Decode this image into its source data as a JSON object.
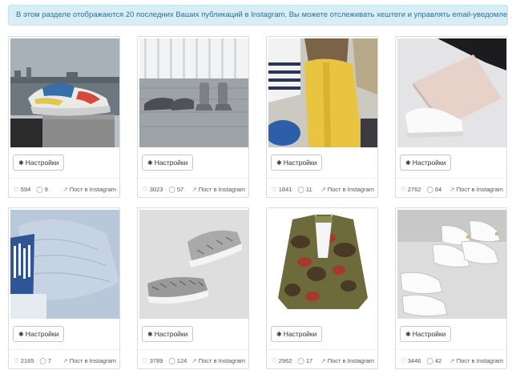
{
  "info_text": "В этом разделе отображаются 20 последних Ваших публикаций в Instagram. Вы можете отслеживать хештеги и управлять email-уведомлениями.",
  "settings_label": "Настройки",
  "post_link_label": "Пост в Instagram",
  "icons": {
    "settings": "gear-icon",
    "likes": "heart-icon",
    "comments": "comment-icon",
    "post": "external-link-icon"
  },
  "colors": {
    "info_bg": "#d9edf7",
    "info_text": "#31708f",
    "card_border": "#dcdcdc"
  },
  "posts": [
    {
      "likes": "594",
      "comments": "9",
      "image": "sneakers-on-pier"
    },
    {
      "likes": "3023",
      "comments": "57",
      "image": "grey-shoes-on-deck"
    },
    {
      "likes": "1841",
      "comments": "11",
      "image": "flatlay-yellow-shirt"
    },
    {
      "likes": "2762",
      "comments": "64",
      "image": "white-sneakers-with-box"
    },
    {
      "likes": "2165",
      "comments": "7",
      "image": "folded-blue-shirt"
    },
    {
      "likes": "3789",
      "comments": "124",
      "image": "zebra-running-shoes"
    },
    {
      "likes": "2962",
      "comments": "17",
      "image": "camo-jacket"
    },
    {
      "likes": "3446",
      "comments": "42",
      "image": "white-sneakers-row"
    }
  ]
}
